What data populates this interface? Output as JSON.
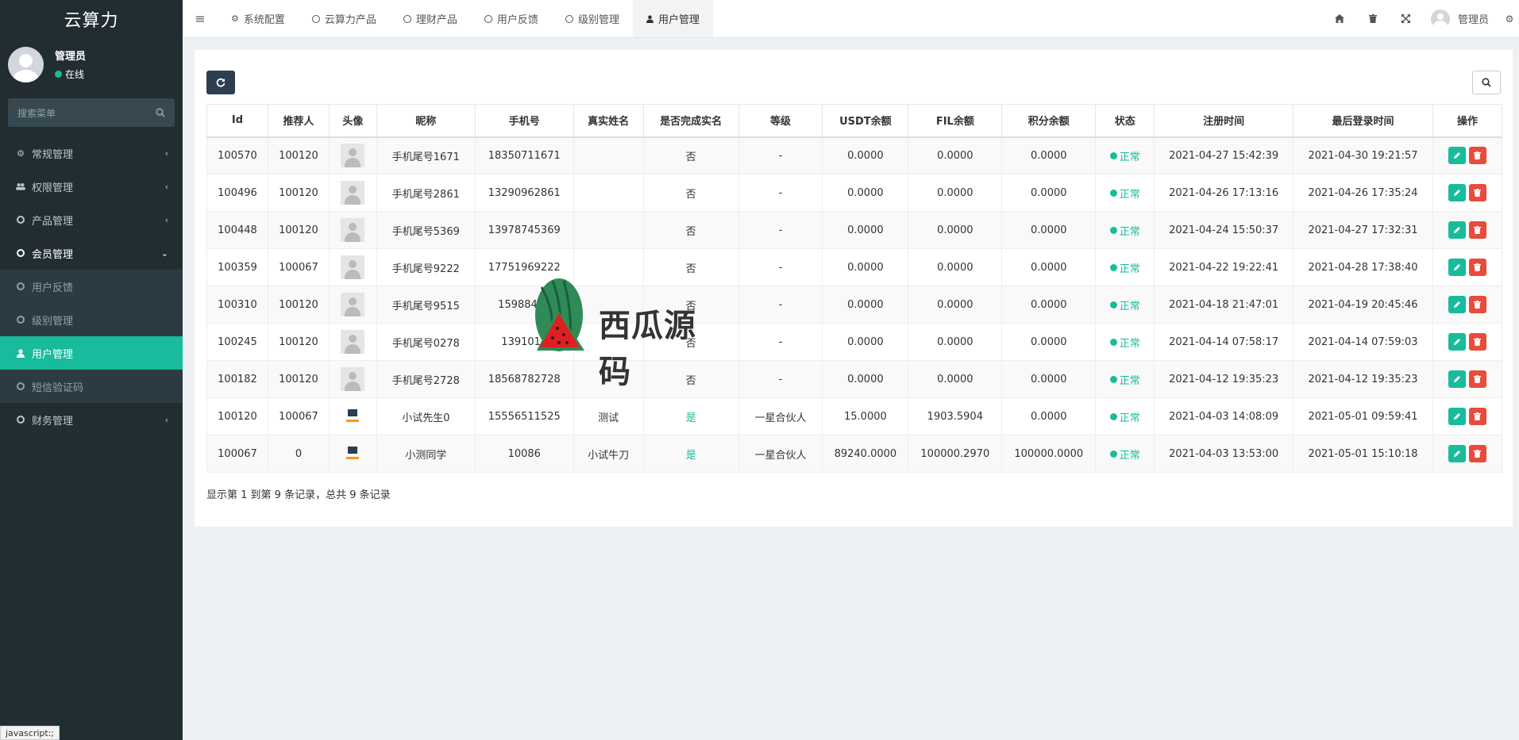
{
  "brand": "云算力",
  "user": {
    "name": "管理员",
    "status": "在线"
  },
  "sidebar": {
    "search_placeholder": "搜索菜单",
    "items": [
      {
        "label": "常规管理",
        "icon": "cogs-icon"
      },
      {
        "label": "权限管理",
        "icon": "group-icon"
      },
      {
        "label": "产品管理",
        "icon": "circle-icon"
      },
      {
        "label": "会员管理",
        "icon": "circle-icon"
      }
    ],
    "sub_items": [
      {
        "label": "用户反馈"
      },
      {
        "label": "级别管理"
      },
      {
        "label": "用户管理"
      },
      {
        "label": "短信验证码"
      }
    ],
    "finance": {
      "label": "财务管理"
    }
  },
  "topbar": {
    "tabs": [
      {
        "label": "系统配置"
      },
      {
        "label": "云算力产品"
      },
      {
        "label": "理财产品"
      },
      {
        "label": "用户反馈"
      },
      {
        "label": "级别管理"
      },
      {
        "label": "用户管理"
      }
    ],
    "user_label": "管理员"
  },
  "table": {
    "headers": [
      "Id",
      "推荐人",
      "头像",
      "昵称",
      "手机号",
      "真实姓名",
      "是否完成实名",
      "等级",
      "USDT余额",
      "FIL余额",
      "积分余额",
      "状态",
      "注册时间",
      "最后登录时间",
      "操作"
    ],
    "rows": [
      {
        "id": "100570",
        "ref": "100120",
        "avatar": "default",
        "nick": "手机尾号1671",
        "phone": "18350711671",
        "real": "",
        "verified": "否",
        "level": "-",
        "usdt": "0.0000",
        "fil": "0.0000",
        "points": "0.0000",
        "status": "正常",
        "reg": "2021-04-27 15:42:39",
        "login": "2021-04-30 19:21:57"
      },
      {
        "id": "100496",
        "ref": "100120",
        "avatar": "default",
        "nick": "手机尾号2861",
        "phone": "13290962861",
        "real": "",
        "verified": "否",
        "level": "-",
        "usdt": "0.0000",
        "fil": "0.0000",
        "points": "0.0000",
        "status": "正常",
        "reg": "2021-04-26 17:13:16",
        "login": "2021-04-26 17:35:24"
      },
      {
        "id": "100448",
        "ref": "100120",
        "avatar": "default",
        "nick": "手机尾号5369",
        "phone": "13978745369",
        "real": "",
        "verified": "否",
        "level": "-",
        "usdt": "0.0000",
        "fil": "0.0000",
        "points": "0.0000",
        "status": "正常",
        "reg": "2021-04-24 15:50:37",
        "login": "2021-04-27 17:32:31"
      },
      {
        "id": "100359",
        "ref": "100067",
        "avatar": "default",
        "nick": "手机尾号9222",
        "phone": "17751969222",
        "real": "",
        "verified": "否",
        "level": "-",
        "usdt": "0.0000",
        "fil": "0.0000",
        "points": "0.0000",
        "status": "正常",
        "reg": "2021-04-22 19:22:41",
        "login": "2021-04-28 17:38:40"
      },
      {
        "id": "100310",
        "ref": "100120",
        "avatar": "default",
        "nick": "手机尾号9515",
        "phone": "15988429",
        "real": "",
        "verified": "否",
        "level": "-",
        "usdt": "0.0000",
        "fil": "0.0000",
        "points": "0.0000",
        "status": "正常",
        "reg": "2021-04-18 21:47:01",
        "login": "2021-04-19 20:45:46"
      },
      {
        "id": "100245",
        "ref": "100120",
        "avatar": "default",
        "nick": "手机尾号0278",
        "phone": "1391014",
        "real": "",
        "verified": "否",
        "level": "-",
        "usdt": "0.0000",
        "fil": "0.0000",
        "points": "0.0000",
        "status": "正常",
        "reg": "2021-04-14 07:58:17",
        "login": "2021-04-14 07:59:03"
      },
      {
        "id": "100182",
        "ref": "100120",
        "avatar": "default",
        "nick": "手机尾号2728",
        "phone": "18568782728",
        "real": "",
        "verified": "否",
        "level": "-",
        "usdt": "0.0000",
        "fil": "0.0000",
        "points": "0.0000",
        "status": "正常",
        "reg": "2021-04-12 19:35:23",
        "login": "2021-04-12 19:35:23"
      },
      {
        "id": "100120",
        "ref": "100067",
        "avatar": "brand",
        "nick": "小试先生0",
        "phone": "15556511525",
        "real": "测试",
        "verified": "是",
        "level": "一星合伙人",
        "usdt": "15.0000",
        "fil": "1903.5904",
        "points": "0.0000",
        "status": "正常",
        "reg": "2021-04-03 14:08:09",
        "login": "2021-05-01 09:59:41"
      },
      {
        "id": "100067",
        "ref": "0",
        "avatar": "brand",
        "nick": "小测同学",
        "phone": "10086",
        "real": "小试牛刀",
        "verified": "是",
        "level": "一星合伙人",
        "usdt": "89240.0000",
        "fil": "100000.2970",
        "points": "100000.0000",
        "status": "正常",
        "reg": "2021-04-03 13:53:00",
        "login": "2021-05-01 15:10:18"
      }
    ]
  },
  "pager_text": "显示第 1 到第 9 条记录，总共 9 条记录",
  "watermark": "西瓜源码",
  "statusbar": "javascript:;",
  "colors": {
    "accent": "#18bc9c",
    "danger": "#e74c3c",
    "sidebar": "#222d32",
    "primary": "#2c3e50"
  }
}
